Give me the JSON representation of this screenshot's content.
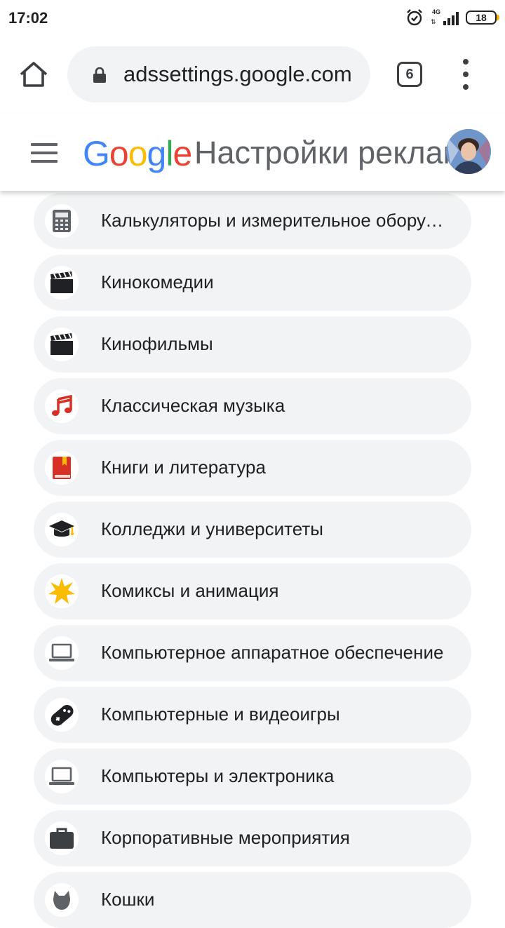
{
  "status_bar": {
    "time": "17:02",
    "network": "4G",
    "battery": "18"
  },
  "browser": {
    "url": "adssettings.google.com",
    "tab_count": "6"
  },
  "header": {
    "logo": [
      "G",
      "o",
      "o",
      "g",
      "l",
      "e"
    ],
    "logo_colors": [
      "#4285F4",
      "#EA4335",
      "#FBBC05",
      "#4285F4",
      "#34A853",
      "#EA4335"
    ],
    "title": "Настройки рекламы"
  },
  "topics": [
    {
      "label": "Калькуляторы и измерительное оборудование",
      "icon": "calculator-icon"
    },
    {
      "label": "Кинокомедии",
      "icon": "clapperboard-icon"
    },
    {
      "label": "Кинофильмы",
      "icon": "clapperboard-icon"
    },
    {
      "label": "Классическая музыка",
      "icon": "music-note-icon"
    },
    {
      "label": "Книги и литература",
      "icon": "book-icon"
    },
    {
      "label": "Колледжи и университеты",
      "icon": "graduation-cap-icon"
    },
    {
      "label": "Комиксы и анимация",
      "icon": "star-burst-icon"
    },
    {
      "label": "Компьютерное аппаратное обеспечение",
      "icon": "laptop-icon"
    },
    {
      "label": "Компьютерные и видеоигры",
      "icon": "gamepad-icon"
    },
    {
      "label": "Компьютеры и электроника",
      "icon": "laptop-icon"
    },
    {
      "label": "Корпоративные мероприятия",
      "icon": "briefcase-icon"
    },
    {
      "label": "Кошки",
      "icon": "cat-icon"
    }
  ]
}
